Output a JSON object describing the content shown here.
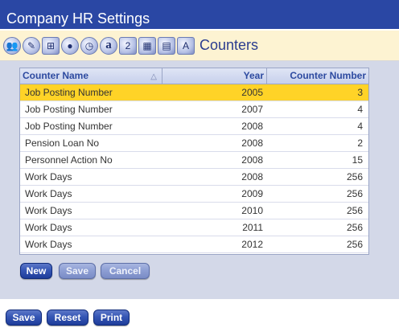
{
  "window": {
    "title": "Company HR Settings"
  },
  "toolbar": {
    "icons": [
      {
        "name": "user-group-icon",
        "glyph": "👥"
      },
      {
        "name": "user-edit-icon",
        "glyph": "✎"
      },
      {
        "name": "org-chart-icon",
        "glyph": "⊞"
      },
      {
        "name": "person-icon",
        "glyph": "●"
      },
      {
        "name": "clock-icon",
        "glyph": "◷"
      },
      {
        "name": "letter-a-icon",
        "glyph": "a"
      },
      {
        "name": "number-two-icon",
        "glyph": "2"
      },
      {
        "name": "calendar-grid-icon",
        "glyph": "▦"
      },
      {
        "name": "document-icon",
        "glyph": "▤"
      },
      {
        "name": "counter-add-icon",
        "glyph": "A"
      }
    ],
    "section_title": "Counters"
  },
  "grid": {
    "columns": {
      "name": "Counter Name",
      "year": "Year",
      "number": "Counter Number"
    },
    "sort_icon": "triangle-up-icon",
    "rows": [
      {
        "name": "Job Posting Number",
        "year": "2005",
        "number": "3",
        "selected": true
      },
      {
        "name": "Job Posting Number",
        "year": "2007",
        "number": "4",
        "selected": false
      },
      {
        "name": "Job Posting Number",
        "year": "2008",
        "number": "4",
        "selected": false
      },
      {
        "name": "Pension Loan No",
        "year": "2008",
        "number": "2",
        "selected": false
      },
      {
        "name": "Personnel Action No",
        "year": "2008",
        "number": "15",
        "selected": false
      },
      {
        "name": "Work Days",
        "year": "2008",
        "number": "256",
        "selected": false
      },
      {
        "name": "Work Days",
        "year": "2009",
        "number": "256",
        "selected": false
      },
      {
        "name": "Work Days",
        "year": "2010",
        "number": "256",
        "selected": false
      },
      {
        "name": "Work Days",
        "year": "2011",
        "number": "256",
        "selected": false
      },
      {
        "name": "Work Days",
        "year": "2012",
        "number": "256",
        "selected": false
      }
    ]
  },
  "grid_buttons": {
    "new": "New",
    "save": "Save",
    "cancel": "Cancel"
  },
  "footer_buttons": {
    "save": "Save",
    "reset": "Reset",
    "print": "Print"
  },
  "colors": {
    "title_bar": "#2a47a4",
    "selected_row": "#ffd327",
    "toolbar_bg": "#fdf3d2",
    "panel_bg": "#d3d8e8"
  }
}
